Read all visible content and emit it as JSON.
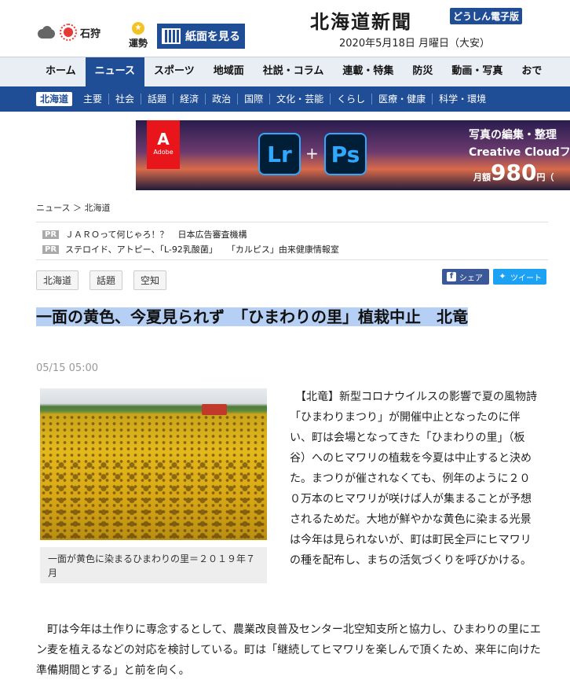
{
  "header": {
    "weather_city": "石狩",
    "fortune_label": "運勢",
    "paper_button": "紙面を見る",
    "logo": "北海道新聞",
    "logo_sub": "どうしん電子版",
    "date": "2020年5月18日 月曜日（大安）"
  },
  "nav_main": [
    "ホーム",
    "ニュース",
    "スポーツ",
    "地域面",
    "社説・コラム",
    "連載・特集",
    "防災",
    "動画・写真",
    "おで"
  ],
  "nav_main_active": "ニュース",
  "nav_sub": [
    "北海道",
    "主要",
    "社会",
    "話題",
    "経済",
    "政治",
    "国際",
    "文化・芸能",
    "くらし",
    "医療・健康",
    "科学・環境"
  ],
  "nav_sub_active": "北海道",
  "ad": {
    "brand": "Adobe",
    "app1": "Lr",
    "app2": "Ps",
    "line1": "写真の編集・整理",
    "line2": "Creative Cloudフォ",
    "price_prefix": "月額",
    "price": "980",
    "price_suffix": "円（"
  },
  "breadcrumb": "ニュース ＞ 北海道",
  "pr_links": [
    {
      "tag": "PR",
      "text": "ＪＡＲＯって何じゃろ！？",
      "source": "日本広告審査機構"
    },
    {
      "tag": "PR",
      "text": "ステロイド、アトピー、「L-92乳酸菌」",
      "source": "「カルピス」由来健康情報室"
    }
  ],
  "tags": [
    "北海道",
    "話題",
    "空知"
  ],
  "share": {
    "facebook": "シェア",
    "twitter": "ツイート"
  },
  "article": {
    "headline": "一面の黄色、今夏見られず　「ひまわりの里」植栽中止　北竜",
    "time": "05/15 05:00",
    "caption": "一面が黄色に染まるひまわりの里＝２０１９年７月",
    "para1": "　【北竜】新型コロナウイルスの影響で夏の風物詩「ひまわりまつり」が開催中止となったのに伴い、町は会場となってきた「ひまわりの里」（板谷）へのヒマワリの植栽を今夏は中止すると決めた。まつりが催されなくても、例年のように２００万本のヒマワリが咲けば人が集まることが予想されるためだ。大地が鮮やかな黄色に染まる光景は今年は見られないが、町は町民全戸にヒマワリの種を配布し、まちの活気づくりを呼びかける。",
    "para2": "　町は今年は土作りに専念するとして、農業改良普及センター北空知支所と協力し、ひまわりの里にエン麦を植えるなどの対応を検討している。町は「継続してヒマワリを楽しんで頂くため、来年に向けた準備期間とする」と前を向く。"
  },
  "colors": {
    "brand": "#1f4d96",
    "nav_bg": "#e9eef5",
    "highlight": "#b6d0f5"
  }
}
